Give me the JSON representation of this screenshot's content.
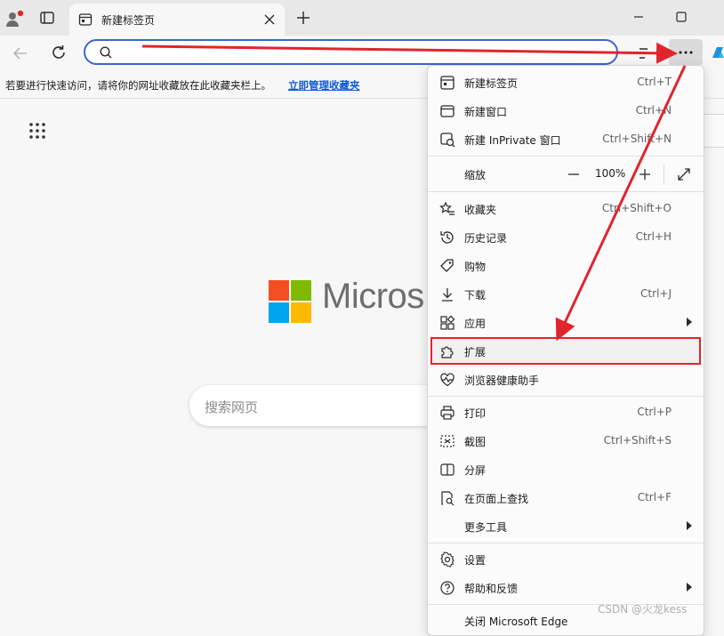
{
  "tab": {
    "title": "新建标签页"
  },
  "address": {
    "placeholder": ""
  },
  "favorites_bar": {
    "text": "若要进行快速访问，请将你的网址收藏放在此收藏夹栏上。",
    "link": "立即管理收藏夹"
  },
  "brand": {
    "word": "Micros"
  },
  "search": {
    "placeholder": "搜索网页"
  },
  "menu": {
    "new_tab": {
      "label": "新建标签页",
      "shortcut": "Ctrl+T"
    },
    "new_window": {
      "label": "新建窗口",
      "shortcut": "Ctrl+N"
    },
    "new_inprivate": {
      "label": "新建 InPrivate 窗口",
      "shortcut": "Ctrl+Shift+N"
    },
    "zoom": {
      "label": "缩放",
      "value": "100%"
    },
    "favorites": {
      "label": "收藏夹",
      "shortcut": "Ctrl+Shift+O"
    },
    "history": {
      "label": "历史记录",
      "shortcut": "Ctrl+H"
    },
    "shopping": {
      "label": "购物"
    },
    "downloads": {
      "label": "下载",
      "shortcut": "Ctrl+J"
    },
    "apps": {
      "label": "应用"
    },
    "extensions": {
      "label": "扩展"
    },
    "browser_health": {
      "label": "浏览器健康助手"
    },
    "print": {
      "label": "打印",
      "shortcut": "Ctrl+P"
    },
    "screenshot": {
      "label": "截图",
      "shortcut": "Ctrl+Shift+S"
    },
    "split_screen": {
      "label": "分屏"
    },
    "find": {
      "label": "在页面上查找",
      "shortcut": "Ctrl+F"
    },
    "more_tools": {
      "label": "更多工具"
    },
    "settings": {
      "label": "设置"
    },
    "help": {
      "label": "帮助和反馈"
    },
    "close_edge": {
      "label": "关闭 Microsoft Edge"
    }
  },
  "watermark": "CSDN @火龙kess",
  "colors": {
    "accent": "#3b67c9",
    "highlight": "#e0252d",
    "link": "#0f5bd8"
  }
}
